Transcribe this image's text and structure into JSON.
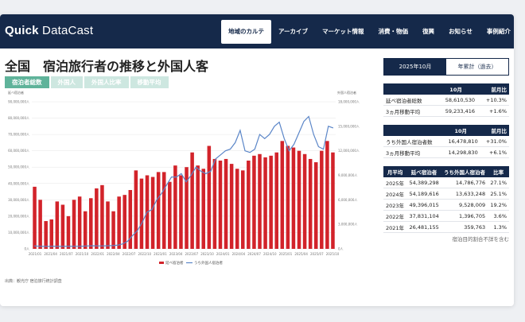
{
  "header": {
    "logo_bold": "Quick",
    "logo_rest": " DataCast",
    "nav": [
      "地域のカルテ",
      "アーカイブ",
      "マーケット情報",
      "消費・物価",
      "復興",
      "お知らせ",
      "事例紹介"
    ]
  },
  "page": {
    "title": "全国　宿泊旅行者の推移と外国人客",
    "tabs": [
      "宿泊者総数",
      "外国人",
      "外国人比率",
      "移動平均"
    ],
    "source": "出典：観光庁 宿泊旅行統計調査"
  },
  "chart_data": {
    "type": "bar",
    "left_axis_title": "延べ宿泊者",
    "right_axis_title": "外国人宿泊者",
    "left_ticks": [
      "90,000,000人",
      "80,000,000人",
      "70,000,000人",
      "60,000,000人",
      "50,000,000人",
      "40,000,000人",
      "30,000,000人",
      "20,000,000人",
      "10,000,000人",
      "0人"
    ],
    "right_ticks": [
      "18,000,000人",
      "15,000,000人",
      "12,000,000人",
      "9,000,000人",
      "6,000,000人",
      "3,000,000人",
      "0人"
    ],
    "left_ylim": [
      0,
      90000000
    ],
    "right_ylim": [
      0,
      18000000
    ],
    "x_ticks": [
      "2021/01",
      "2021/04",
      "2021/07",
      "2021/10",
      "2022/01",
      "2022/04",
      "2022/07",
      "2022/10",
      "2023/01",
      "2023/04",
      "2023/07",
      "2023/10",
      "2024/01",
      "2024/04",
      "2024/07",
      "2024/10",
      "2025/01",
      "2025/04",
      "2025/07",
      "2025/10"
    ],
    "series": [
      {
        "name": "延べ宿泊者",
        "color": "#d2232a",
        "type": "bar",
        "values": [
          38,
          30,
          17,
          18,
          29,
          27,
          20,
          30,
          32,
          23,
          31,
          37,
          39,
          29,
          23,
          32,
          33,
          36,
          48,
          43,
          45,
          44,
          47,
          47,
          41,
          51,
          45,
          50,
          59,
          51,
          49,
          63,
          55,
          54,
          55,
          52,
          49,
          48,
          54,
          57,
          58,
          56,
          57,
          59,
          66,
          63,
          62,
          60,
          58,
          55,
          53,
          60,
          66,
          59
        ]
      },
      {
        "name": "うち外国人宿泊者",
        "color": "#5b86c8",
        "type": "line",
        "values": [
          0.35,
          0.32,
          0.3,
          0.3,
          0.32,
          0.3,
          0.31,
          0.32,
          0.31,
          0.31,
          0.33,
          0.36,
          0.38,
          0.36,
          0.36,
          0.38,
          0.4,
          0.45,
          0.6,
          0.9,
          1.6,
          2.2,
          3.2,
          4.5,
          4.8,
          6.0,
          6.8,
          7.8,
          8.8,
          8.8,
          9.2,
          8.2,
          9.0,
          10.0,
          9.5,
          9.2,
          9.5,
          11.0,
          11.5,
          12.0,
          12.2,
          13.0,
          14.5,
          12.0,
          11.8,
          12.2,
          14.0,
          13.5,
          14.0,
          15.0,
          15.5,
          13.5,
          12.0,
          12.8,
          14.2,
          15.6,
          16.2,
          14.0,
          12.5,
          12.2,
          15.0,
          14.8
        ]
      }
    ],
    "legend": [
      "延べ宿泊者",
      "うち外国人宿泊者"
    ]
  },
  "panel": {
    "toggle": [
      "2025年10月",
      "年累計（過去）"
    ],
    "t1": {
      "headers": [
        "",
        "10月",
        "前月比"
      ],
      "rows": [
        [
          "延べ宿泊者総数",
          "58,610,530",
          "+10.3%"
        ],
        [
          "3ヵ月移動平均",
          "59,233,416",
          "+1.6%"
        ]
      ]
    },
    "t2": {
      "headers": [
        "",
        "10月",
        "前月比"
      ],
      "rows": [
        [
          "うち外国人宿泊者数",
          "16,478,810",
          "+31.0%"
        ],
        [
          "3ヵ月移動平均",
          "14,298,830",
          "+6.1%"
        ]
      ]
    },
    "t3": {
      "headers": [
        "月平均",
        "延べ宿泊者",
        "うち外国人宿泊者",
        "比率"
      ],
      "rows": [
        [
          "2025年",
          "54,389,298",
          "14,786,776",
          "27.1%"
        ],
        [
          "2024年",
          "54,189,616",
          "13,633,248",
          "25.1%"
        ],
        [
          "2023年",
          "49,396,015",
          "9,528,009",
          "19.2%"
        ],
        [
          "2022年",
          "37,831,104",
          "1,396,705",
          "3.6%"
        ],
        [
          "2021年",
          "26,481,155",
          "359,763",
          "1.3%"
        ]
      ]
    },
    "note": "宿泊目的割合不詳を含む"
  }
}
